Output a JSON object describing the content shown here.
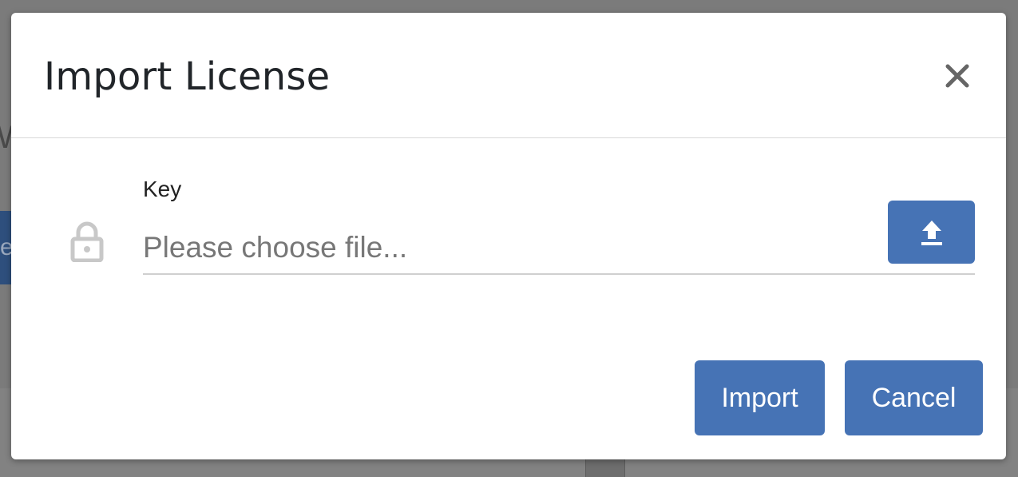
{
  "background": {
    "partial_text": "W",
    "partial_button_text": "e"
  },
  "modal": {
    "title": "Import License",
    "close_icon": "close-icon",
    "field": {
      "label": "Key",
      "placeholder": "Please choose file...",
      "value": "",
      "lock_icon": "lock-icon",
      "upload_icon": "upload-icon"
    },
    "footer": {
      "import_label": "Import",
      "cancel_label": "Cancel"
    }
  },
  "colors": {
    "primary": "#4673b5",
    "overlay": "#7b7b7b",
    "title": "#212529",
    "icon_muted": "#c8c8c8",
    "close_icon": "#666666"
  }
}
